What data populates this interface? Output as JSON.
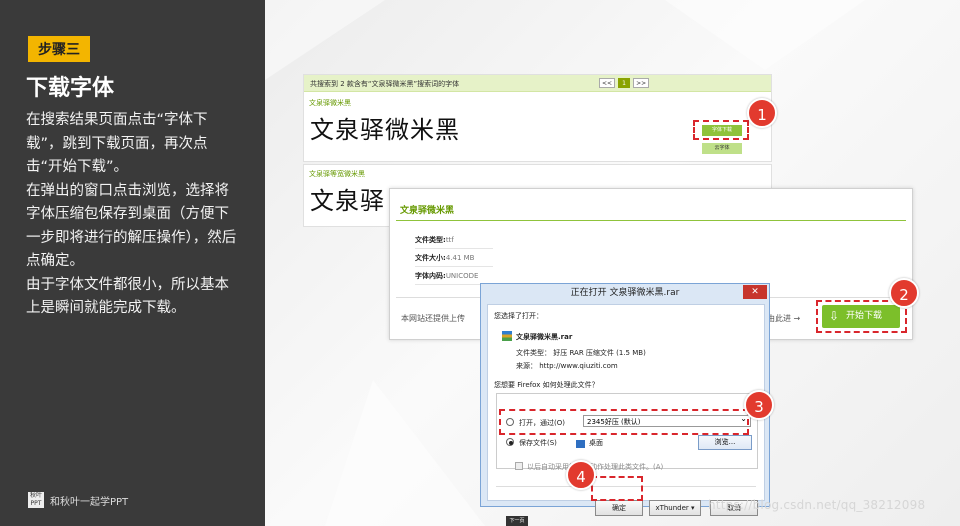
{
  "sidebar": {
    "step_label": "步骤三",
    "title": "下载字体",
    "paragraphs": [
      "在搜索结果页面点击“字体下载”，跳到下载页面，再次点击“开始下载”。",
      "在弹出的窗口点击浏览，选择将字体压缩包保存到桌面（方便下一步即将进行的解压操作），然后点确定。",
      "由于字体文件都很小，所以基本上是瞬间就能完成下载。"
    ],
    "brand_logo": "秋叶 PPT",
    "brand_text": "和秋叶一起学PPT"
  },
  "search_page": {
    "result_summary": "共搜索到 2 款含有“文泉驿微米黑”搜索词的字体",
    "pager": {
      "prev": "<<",
      "current": "1",
      "next": ">>"
    },
    "results": [
      {
        "name": "文泉驿微米黑",
        "preview": "文泉驿微米黑",
        "download_label": "字体下载",
        "cloud_label": "云字体"
      },
      {
        "name": "文泉驿等宽微米黑",
        "preview": "文泉驿"
      }
    ]
  },
  "download_page": {
    "font_name": "文泉驿微米黑",
    "file_type_label": "文件类型:",
    "file_type": "ttf",
    "file_size_label": "文件大小:",
    "file_size": "4.41 MB",
    "font_code_label": "字体内码:",
    "font_code": "UNICODE",
    "note_left": "本网站还提供上传",
    "note_right": "由此进 →",
    "start_button": "开始下载",
    "start_icon": "download-arrow-icon"
  },
  "dialog": {
    "title": "正在打开 文泉驿微米黑.rar",
    "close": "✕",
    "chosen_label": "您选择了打开：",
    "file_name": "文泉驿微米黑.rar",
    "file_type_line": "文件类型：  好压 RAR 压缩文件 (1.5 MB)",
    "source_line": "来源：  http://www.qiuziti.com",
    "question": "您想要 Firefox 如何处理此文件？",
    "open_with_label": "打开，通过(O)",
    "open_with_value": "2345好压 (默认)",
    "save_label": "保存文件(S)",
    "save_target": "桌面",
    "browse_button": "浏览...",
    "remember_label": "以后自动采用相同的动作处理此类文件。(A)",
    "ok_button": "确定",
    "xthunder_button": "xThunder ▾",
    "cancel_button": "取消"
  },
  "callouts": [
    "1",
    "2",
    "3",
    "4"
  ],
  "watermark": "https://blog.csdn.net/qq_38212098",
  "next_tab": "下一页",
  "colors": {
    "sidebar_bg": "#3a3a3a",
    "step_badge": "#f3b500",
    "callout_red": "#e23a2e",
    "green": "#7cbf2a"
  }
}
